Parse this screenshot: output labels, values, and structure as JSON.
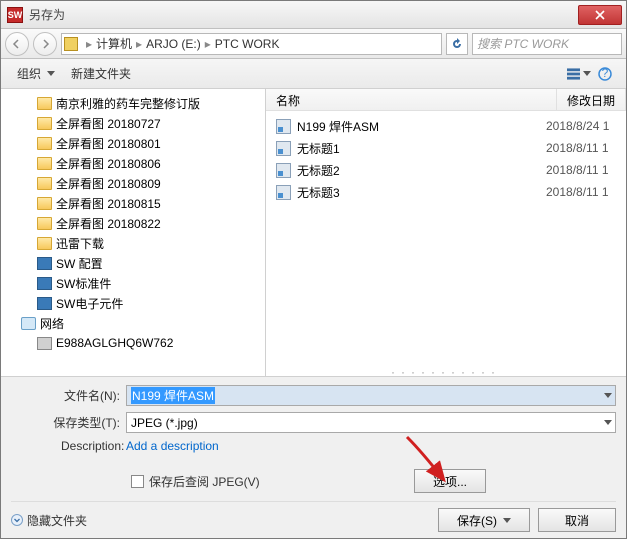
{
  "window": {
    "title": "另存为"
  },
  "breadcrumb": {
    "segments": [
      "计算机",
      "ARJO (E:)",
      "PTC WORK"
    ]
  },
  "search": {
    "placeholder": "搜索 PTC WORK"
  },
  "toolbar": {
    "organize": "组织",
    "newfolder": "新建文件夹"
  },
  "tree": {
    "items": [
      {
        "label": "南京利雅的药车完整修订版",
        "icon": "folder",
        "level": 1
      },
      {
        "label": "全屏看图 20180727",
        "icon": "folder",
        "level": 1
      },
      {
        "label": "全屏看图 20180801",
        "icon": "folder",
        "level": 1
      },
      {
        "label": "全屏看图 20180806",
        "icon": "folder",
        "level": 1
      },
      {
        "label": "全屏看图 20180809",
        "icon": "folder",
        "level": 1
      },
      {
        "label": "全屏看图 20180815",
        "icon": "folder",
        "level": 1
      },
      {
        "label": "全屏看图 20180822",
        "icon": "folder",
        "level": 1
      },
      {
        "label": "迅雷下载",
        "icon": "folder",
        "level": 1
      },
      {
        "label": "SW 配置",
        "icon": "sw",
        "level": 1
      },
      {
        "label": "SW标准件",
        "icon": "sw",
        "level": 1
      },
      {
        "label": "SW电子元件",
        "icon": "sw",
        "level": 1
      },
      {
        "label": "网络",
        "icon": "network",
        "level": 0
      },
      {
        "label": "E988AGLGHQ6W762",
        "icon": "computer",
        "level": 1
      }
    ]
  },
  "fileheader": {
    "name": "名称",
    "date": "修改日期"
  },
  "files": [
    {
      "name": "N199 焊件ASM",
      "date": "2018/8/24 1"
    },
    {
      "name": "无标题1",
      "date": "2018/8/11 1"
    },
    {
      "name": "无标题2",
      "date": "2018/8/11 1"
    },
    {
      "name": "无标题3",
      "date": "2018/8/11 1"
    }
  ],
  "form": {
    "filename_label": "文件名(N):",
    "filename_value": "N199 焊件ASM",
    "savetype_label": "保存类型(T):",
    "savetype_value": "JPEG (*.jpg)",
    "description_label": "Description:",
    "description_link": "Add a description",
    "review_checkbox": "保存后查阅 JPEG(V)",
    "options_button": "选项..."
  },
  "footer": {
    "hidefolders": "隐藏文件夹",
    "save": "保存(S)",
    "cancel": "取消"
  }
}
